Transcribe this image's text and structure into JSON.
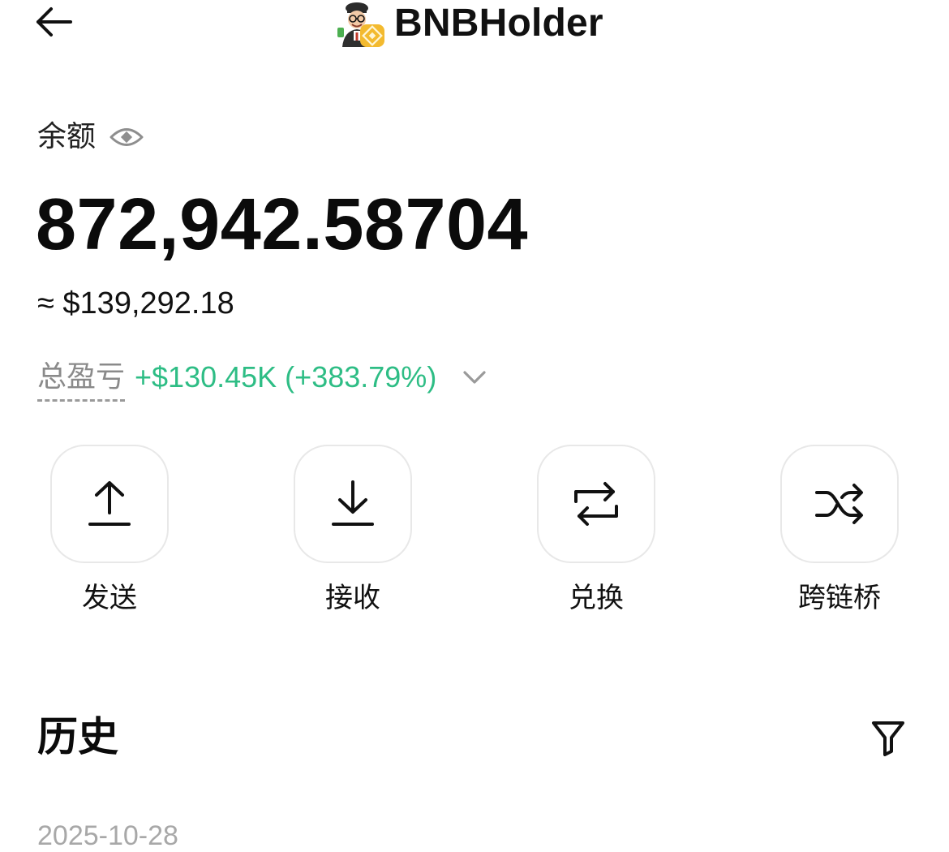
{
  "header": {
    "back_icon": "arrow-left-icon",
    "token_name": "BNBHolder",
    "token_logo_icon": "bnbholder-avatar-icon"
  },
  "balance": {
    "label": "余额",
    "eye_icon": "eye-icon",
    "amount": "872,942.58704",
    "usd_value": "≈ $139,292.18"
  },
  "pnl": {
    "label": "总盈亏",
    "value": "+$130.45K (+383.79%)",
    "color": "#2ebd85",
    "chevron_icon": "chevron-down-icon"
  },
  "actions": [
    {
      "label": "发送",
      "icon": "upload-arrow-icon"
    },
    {
      "label": "接收",
      "icon": "download-arrow-icon"
    },
    {
      "label": "兑换",
      "icon": "swap-icon"
    },
    {
      "label": "跨链桥",
      "icon": "shuffle-icon"
    }
  ],
  "history": {
    "title": "历史",
    "filter_icon": "filter-icon",
    "first_date_partial": "2025-10-28"
  }
}
